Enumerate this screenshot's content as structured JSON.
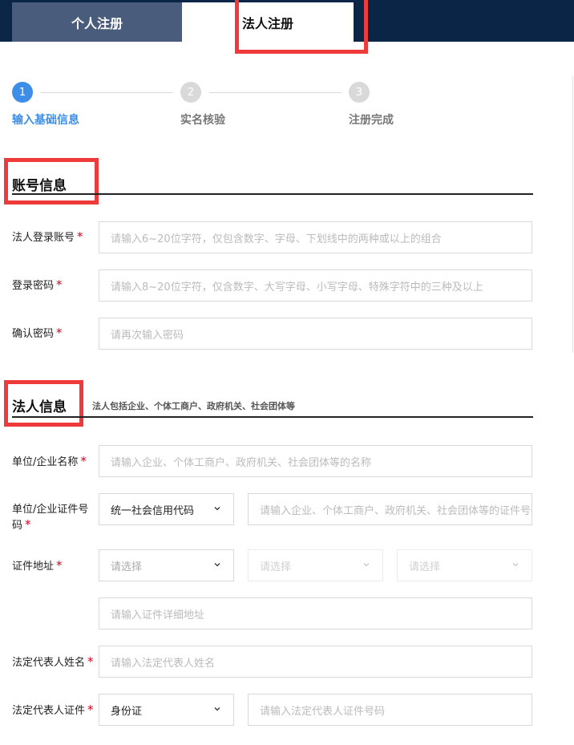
{
  "tabs": {
    "personal": "个人注册",
    "legal": "法人注册"
  },
  "steps": [
    {
      "num": "1",
      "label": "输入基础信息",
      "state": "active"
    },
    {
      "num": "2",
      "label": "实名核验",
      "state": "inactive"
    },
    {
      "num": "3",
      "label": "注册完成",
      "state": "inactive"
    }
  ],
  "account_section": {
    "title": "账号信息",
    "fields": {
      "login": {
        "label": "法人登录账号",
        "placeholder": "请输入6~20位字符，仅包含数字、字母、下划线中的两种或以上的组合"
      },
      "password": {
        "label": "登录密码",
        "placeholder": "请输入8~20位字符，仅含数字、大写字母、小写字母、特殊字符中的三种及以上"
      },
      "confirm": {
        "label": "确认密码",
        "placeholder": "请再次输入密码"
      }
    }
  },
  "legal_section": {
    "title": "法人信息",
    "note": "法人包括企业、个体工商户、政府机关、社会团体等",
    "fields": {
      "org_name": {
        "label": "单位/企业名称",
        "placeholder": "请输入企业、个体工商户、政府机关、社会团体等的名称"
      },
      "cert_no": {
        "label_line1": "单位/企业证件号",
        "label_line2": "码",
        "type_value": "统一社会信用代码",
        "placeholder": "请输入企业、个体工商户、政府机关、社会团体等的证件号码"
      },
      "address": {
        "label": "证件地址",
        "select_placeholder": "请选择",
        "detail_placeholder": "请输入证件详细地址"
      },
      "rep_name": {
        "label": "法定代表人姓名",
        "placeholder": "请输入法定代表人姓名"
      },
      "rep_id": {
        "label": "法定代表人证件",
        "type_value": "身份证",
        "placeholder": "请输入法定代表人证件号码"
      }
    }
  },
  "required_mark": "*",
  "colors": {
    "topbar": "#0b2546",
    "active_step": "#3d8ee8",
    "inactive_step": "#d9d9d9",
    "required": "#d9001b",
    "highlight_box": "#ee3a3a"
  },
  "icons": {
    "select_arrow": "chevron-down-icon"
  }
}
